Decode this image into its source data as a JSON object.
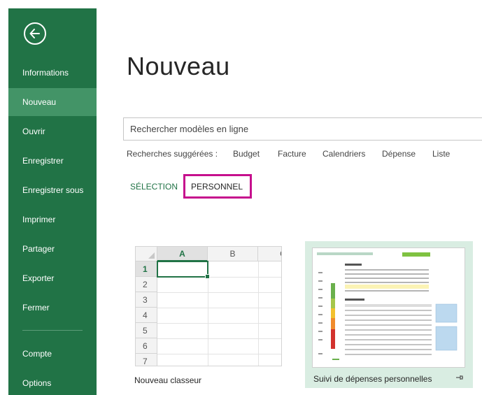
{
  "sidebar": {
    "back_icon": "arrow-left-icon",
    "items": [
      {
        "label": "Informations"
      },
      {
        "label": "Nouveau",
        "active": true
      },
      {
        "label": "Ouvrir"
      },
      {
        "label": "Enregistrer"
      },
      {
        "label": "Enregistrer sous"
      },
      {
        "label": "Imprimer"
      },
      {
        "label": "Partager"
      },
      {
        "label": "Exporter"
      },
      {
        "label": "Fermer"
      },
      {
        "label": "Compte"
      },
      {
        "label": "Options"
      }
    ]
  },
  "main": {
    "title": "Nouveau",
    "search": {
      "placeholder": "Rechercher modèles en ligne"
    },
    "suggestions": {
      "label": "Recherches suggérées :",
      "items": [
        "Budget",
        "Facture",
        "Calendriers",
        "Dépense",
        "Liste"
      ]
    },
    "tabs": [
      {
        "label": "SÉLECTION"
      },
      {
        "label": "PERSONNEL",
        "highlighted": true
      }
    ],
    "templates": [
      {
        "label": "Nouveau classeur",
        "grid": {
          "columns": [
            "A",
            "B",
            "C"
          ],
          "rows": [
            "1",
            "2",
            "3",
            "4",
            "5",
            "6",
            "7"
          ]
        }
      },
      {
        "label": "Suivi de dépenses personnelles",
        "pin_icon": "pin-icon"
      }
    ]
  },
  "colors": {
    "sidebar_bg": "#217346",
    "sidebar_active": "#439467",
    "highlight_border": "#c60f8d",
    "accent": "#217346"
  }
}
